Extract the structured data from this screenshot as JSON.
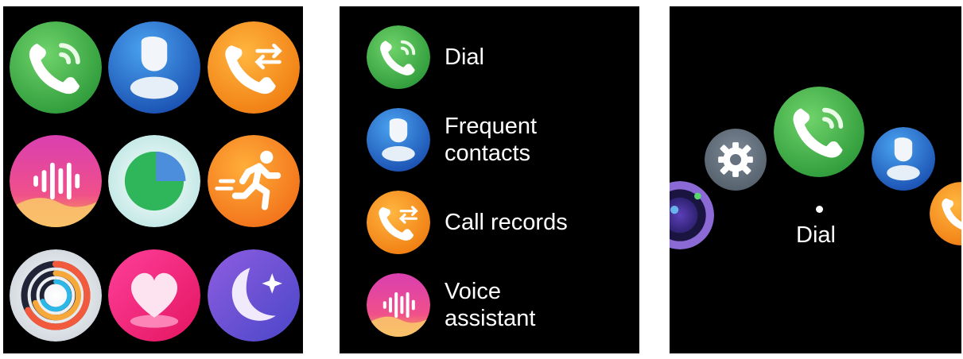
{
  "screens": {
    "grid": {
      "apps": [
        {
          "name": "phone-icon"
        },
        {
          "name": "contacts-icon"
        },
        {
          "name": "call-records-icon"
        },
        {
          "name": "voice-assistant-icon"
        },
        {
          "name": "pie-chart-icon"
        },
        {
          "name": "workout-icon"
        },
        {
          "name": "activity-rings-icon"
        },
        {
          "name": "heart-rate-icon"
        },
        {
          "name": "sleep-icon"
        }
      ]
    },
    "list": {
      "items": [
        {
          "label": "Dial",
          "icon": "phone-icon"
        },
        {
          "label": "Frequent\ncontacts",
          "icon": "contacts-icon"
        },
        {
          "label": "Call records",
          "icon": "call-records-icon"
        },
        {
          "label": "Voice\nassistant",
          "icon": "voice-assistant-icon"
        }
      ]
    },
    "carousel": {
      "focused_label": "Dial",
      "icons": [
        "camera-icon",
        "settings-gear-icon",
        "phone-icon",
        "contacts-icon",
        "call-records-icon"
      ]
    }
  },
  "colors": {
    "phone": "#4caf50",
    "contacts": "#1e6fd0",
    "call_records": "#f59a1b",
    "voice": "#e84a9a",
    "sleep": "#6a4bd1",
    "heart": "#e8196b"
  }
}
